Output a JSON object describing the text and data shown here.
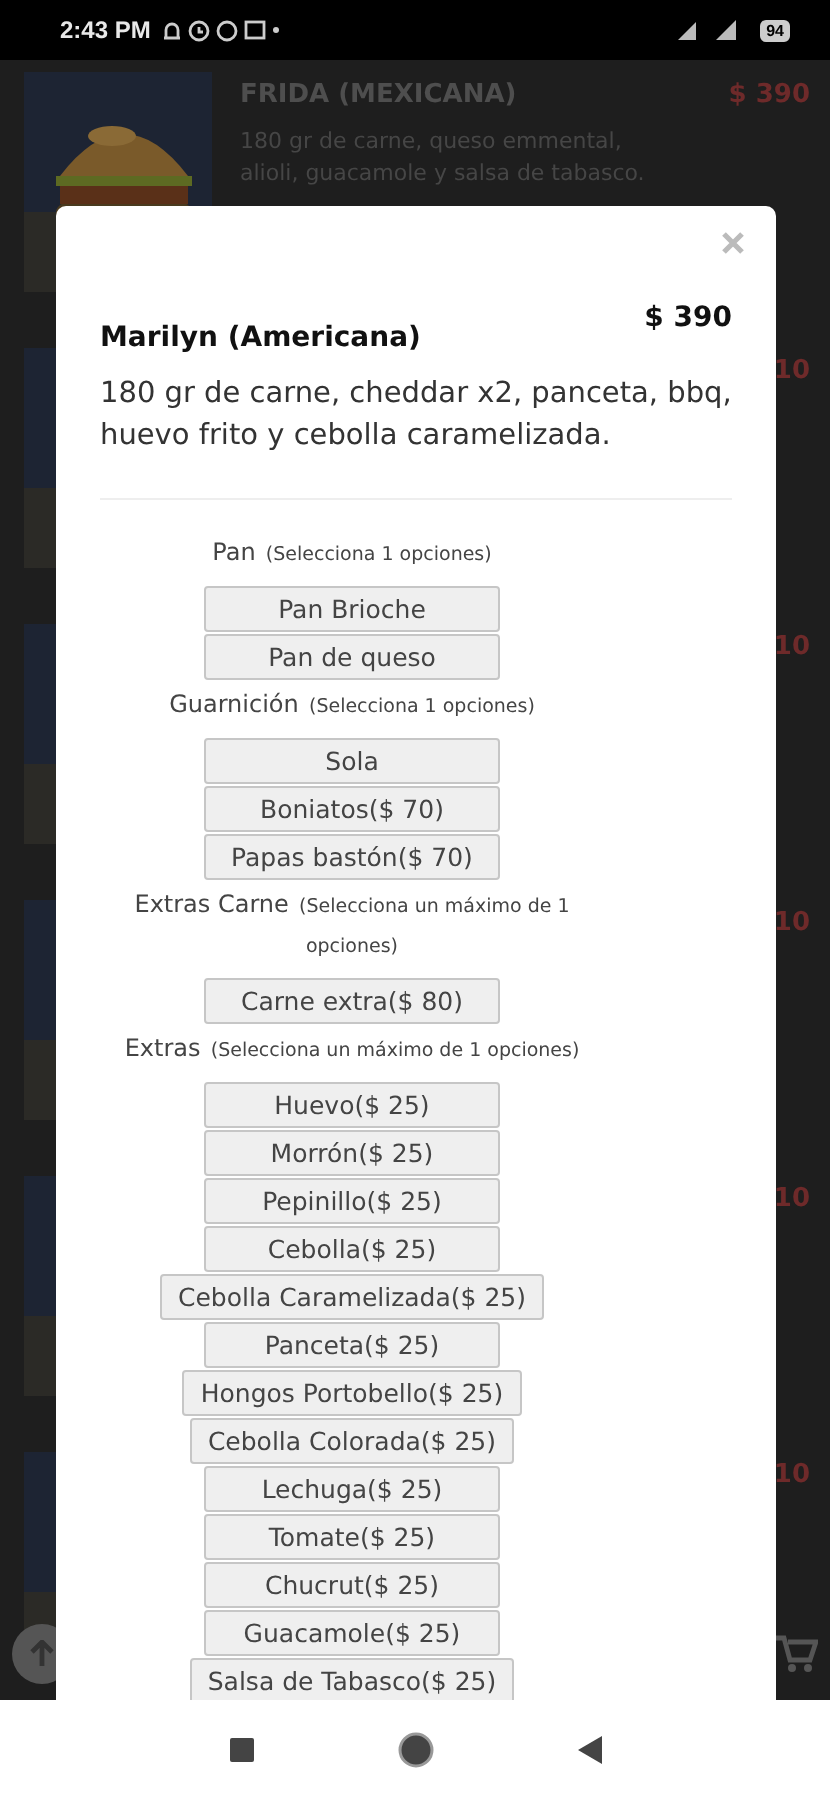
{
  "status_bar": {
    "time": "2:43 PM",
    "battery": "94"
  },
  "menu_items": [
    {
      "name": "FRIDA (MEXICANA)",
      "description": "180 gr de carne, queso emmental, alioli, guacamole y salsa de tabasco.",
      "price": "$ 390"
    },
    {
      "price": "10"
    },
    {
      "price": "10"
    },
    {
      "price": "10"
    },
    {
      "price": "10"
    },
    {
      "price": "10"
    }
  ],
  "modal": {
    "title": "Marilyn (Americana)",
    "price": "$ 390",
    "description": "180 gr de carne, cheddar x2, panceta, bbq, huevo frito y cebolla caramelizada.",
    "groups": [
      {
        "title": "Pan",
        "hint": "(Selecciona 1 opciones)",
        "options": [
          "Pan Brioche",
          "Pan de queso"
        ]
      },
      {
        "title": "Guarnición",
        "hint": "(Selecciona 1 opciones)",
        "options": [
          "Sola",
          "Boniatos($ 70)",
          "Papas bastón($ 70)"
        ]
      },
      {
        "title": "Extras Carne",
        "hint": "(Selecciona un máximo de 1 opciones)",
        "options": [
          "Carne extra($ 80)"
        ]
      },
      {
        "title": "Extras",
        "hint": "(Selecciona un máximo de 1 opciones)",
        "options": [
          "Huevo($ 25)",
          "Morrón($ 25)",
          "Pepinillo($ 25)",
          "Cebolla($ 25)",
          "Cebolla Caramelizada($ 25)",
          "Panceta($ 25)",
          "Hongos Portobello($ 25)",
          "Cebolla Colorada($ 25)",
          "Lechuga($ 25)",
          "Tomate($ 25)",
          "Chucrut($ 25)",
          "Guacamole($ 25)",
          "Salsa de Tabasco($ 25)"
        ]
      }
    ]
  }
}
